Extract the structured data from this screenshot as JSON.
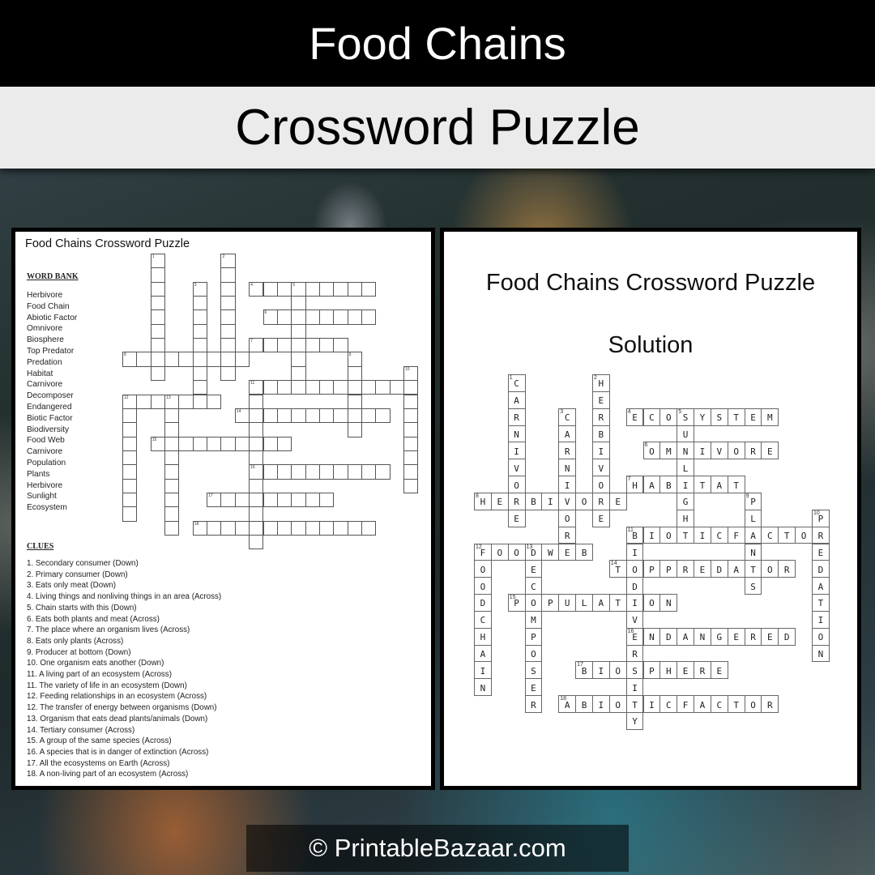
{
  "header": {
    "title": "Food Chains",
    "subtitle": "Crossword Puzzle"
  },
  "puzzle": {
    "title": "Food Chains Crossword Puzzle",
    "word_bank_heading": "WORD BANK",
    "word_bank": [
      "Herbivore",
      "Food Chain",
      "Abiotic Factor",
      "Omnivore",
      "Biosphere",
      "Top Predator",
      "Predation",
      "Habitat",
      "Carnivore",
      "Decomposer",
      "Endangered",
      "Biotic Factor",
      "Biodiversity",
      "Food Web",
      "Carnivore",
      "Population",
      "Plants",
      "Herbivore",
      "Sunlight",
      "Ecosystem"
    ],
    "clues_heading": "CLUES",
    "clues": [
      "1. Secondary consumer (Down)",
      "2. Primary consumer (Down)",
      "3. Eats only meat (Down)",
      "4. Living things and nonliving things in an area (Across)",
      "5. Chain starts with this (Down)",
      "6. Eats both plants and meat (Across)",
      "7. The place where an organism lives (Across)",
      "8. Eats only plants (Across)",
      "9. Producer  at bottom  (Down)",
      "10. One organism eats another (Down)",
      "11. A living part of an ecosystem (Across)",
      "11. The variety of life in an ecosystem (Down)",
      "12. Feeding relationships in an ecosystem (Across)",
      "12. The transfer of energy between organisms (Down)",
      "13. Organism that eats dead plants/animals (Down)",
      "14. Tertiary consumer  (Across)",
      "15. A group of the same species (Across)",
      "16. A species that is in danger of extinction (Across)",
      "17. All the ecosystems on Earth (Across)",
      "18. A non-living part of an ecosystem (Across)"
    ]
  },
  "solution": {
    "title": "Food Chains Crossword Puzzle",
    "subtitle": "Solution"
  },
  "crossword": {
    "entries": [
      {
        "num": 1,
        "dir": "down",
        "row": 0,
        "col": 2,
        "answer": "CARNIVORE"
      },
      {
        "num": 2,
        "dir": "down",
        "row": 0,
        "col": 7,
        "answer": "HERBIVORE"
      },
      {
        "num": 3,
        "dir": "down",
        "row": 2,
        "col": 5,
        "answer": "CARNIVORE"
      },
      {
        "num": 4,
        "dir": "across",
        "row": 2,
        "col": 9,
        "answer": "ECOSYSTEM"
      },
      {
        "num": 5,
        "dir": "down",
        "row": 2,
        "col": 12,
        "answer": "SUNLIGHT"
      },
      {
        "num": 6,
        "dir": "across",
        "row": 4,
        "col": 10,
        "answer": "OMNIVORE"
      },
      {
        "num": 7,
        "dir": "across",
        "row": 6,
        "col": 9,
        "answer": "HABITAT"
      },
      {
        "num": 8,
        "dir": "across",
        "row": 7,
        "col": 0,
        "answer": "HERBIVORE"
      },
      {
        "num": 9,
        "dir": "down",
        "row": 7,
        "col": 16,
        "answer": "PLANTS"
      },
      {
        "num": 10,
        "dir": "down",
        "row": 8,
        "col": 20,
        "answer": "PREDATION"
      },
      {
        "num": 11,
        "dir": "across",
        "row": 9,
        "col": 9,
        "answer": "BIOTICFACTOR"
      },
      {
        "num": 11,
        "dir": "down",
        "row": 9,
        "col": 9,
        "answer": "BIODIVERSITY"
      },
      {
        "num": 12,
        "dir": "across",
        "row": 10,
        "col": 0,
        "answer": "FOODWEB"
      },
      {
        "num": 12,
        "dir": "down",
        "row": 10,
        "col": 0,
        "answer": "FOODCHAIN"
      },
      {
        "num": 13,
        "dir": "down",
        "row": 10,
        "col": 3,
        "answer": "DECOMPOSER"
      },
      {
        "num": 14,
        "dir": "across",
        "row": 11,
        "col": 8,
        "answer": "TOPPREDATOR"
      },
      {
        "num": 15,
        "dir": "across",
        "row": 13,
        "col": 2,
        "answer": "POPULATION"
      },
      {
        "num": 16,
        "dir": "across",
        "row": 15,
        "col": 9,
        "answer": "ENDANGERED"
      },
      {
        "num": 17,
        "dir": "across",
        "row": 17,
        "col": 6,
        "answer": "BIOSPHERE"
      },
      {
        "num": 18,
        "dir": "across",
        "row": 19,
        "col": 5,
        "answer": "ABIOTICFACTOR"
      }
    ]
  },
  "footer": {
    "copyright": "© PrintableBazaar.com"
  }
}
